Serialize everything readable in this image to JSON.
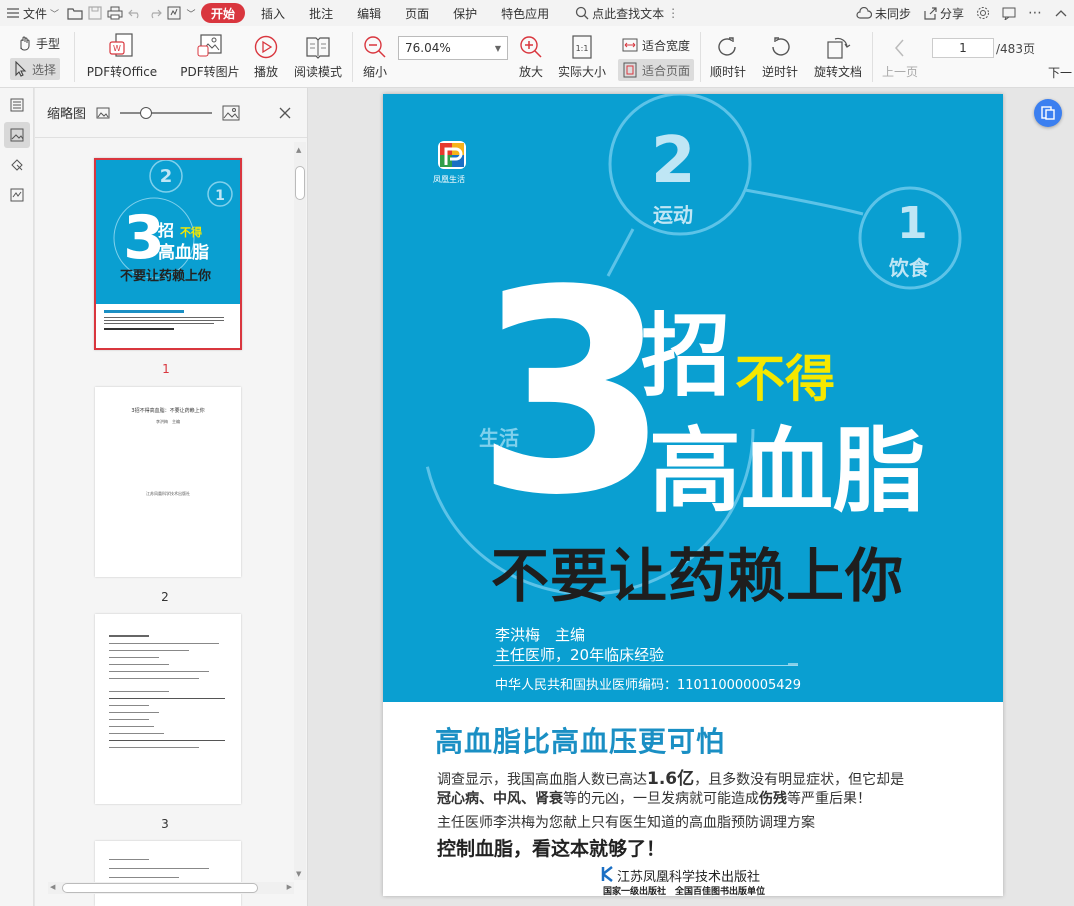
{
  "menubar": {
    "file": "文件",
    "tabs": [
      "开始",
      "插入",
      "批注",
      "编辑",
      "页面",
      "保护",
      "特色应用"
    ],
    "search_placeholder": "点此查找文本",
    "sync": "未同步",
    "share": "分享"
  },
  "ribbon": {
    "hand": "手型",
    "select": "选择",
    "pdf_to_office": "PDF转Office",
    "pdf_to_image": "PDF转图片",
    "play": "播放",
    "read_mode": "阅读模式",
    "zoom_out": "缩小",
    "zoom_value": "76.04%",
    "zoom_in": "放大",
    "actual_size": "实际大小",
    "fit_width": "适合宽度",
    "fit_page": "适合页面",
    "clockwise": "顺时针",
    "counterclockwise": "逆时针",
    "rotate_doc": "旋转文档",
    "prev_page": "上一页",
    "next_page": "下一",
    "current_page": "1",
    "total_pages": "/483页"
  },
  "thumbnails": {
    "title": "缩略图",
    "pages": [
      "1",
      "2",
      "3"
    ],
    "p2_title": "3招不得高血脂：不要让药赖上你",
    "p2_author": "李洪梅　主编",
    "p2_pub": "江苏凤凰科学技术出版社"
  },
  "cover": {
    "brand": "凤凰生活",
    "num_big": "3",
    "circle2_num": "2",
    "circle2_label": "运动",
    "circle1_num": "1",
    "circle1_label": "饮食",
    "life": "生活",
    "zhao": "招",
    "bude": "不得",
    "gaoxuezhi": "高血脂",
    "subtitle": "不要让药赖上你",
    "author": "李洪梅　主编",
    "author_title": "主任医师，20年临床经验",
    "license": "中华人民共和国执业医师编码：110110000005429",
    "headline": "高血脂比高血压更可怕",
    "body1_a": "调查显示，我国高血脂人数已高达",
    "body1_num": "1.6亿",
    "body1_b": "，且多数没有明显症状，但它却是",
    "body2_a": "冠心病、中风、肾衰",
    "body2_b": "等的元凶，一旦发病就可能造成",
    "body2_c": "伤残",
    "body2_d": "等严重后果！",
    "body3": "主任医师李洪梅为您献上只有医生知道的高血脂预防调理方案",
    "body4": "控制血脂，看这本就够了！",
    "publisher": "江苏凤凰科学技术出版社",
    "publisher_sub": "国家一级出版社　全国百佳图书出版单位"
  },
  "colors": {
    "cover_blue": "#0a9fd1",
    "accent_red": "#d9363e",
    "yellow": "#f5e800",
    "headline_blue": "#1a8fc4"
  }
}
